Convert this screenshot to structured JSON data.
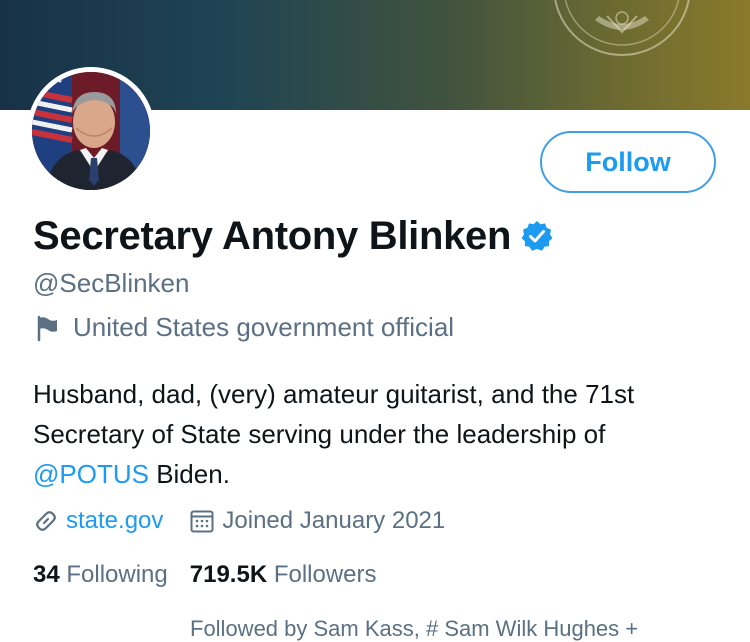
{
  "banner": {
    "colors": [
      "#173247",
      "#8a7a2b"
    ],
    "seal_icon": "state-department-seal"
  },
  "profile": {
    "display_name": "Secretary Antony Blinken",
    "verified_icon": "verified-badge-icon",
    "handle": "@SecBlinken",
    "label_icon": "flag-icon",
    "label": "United States government official",
    "bio": {
      "line1": "Husband, dad, (very) amateur guitarist, and the 71st",
      "line2": "Secretary of State serving under the leadership of",
      "mention": "@POTUS",
      "line3_rest": " Biden."
    },
    "website_icon": "link-icon",
    "website": "state.gov",
    "joined_icon": "calendar-icon",
    "joined": "Joined January 2021"
  },
  "actions": {
    "follow_label": "Follow"
  },
  "stats": {
    "following_count": "34",
    "following_label": "Following",
    "followers_count": "719.5K",
    "followers_label": "Followers"
  },
  "followed_by": "Followed by Sam Kass, # Sam Wilk Hughes +",
  "colors": {
    "accent": "#1d9bf0",
    "secondary_text": "#5b7083",
    "primary_text": "#0f1419"
  }
}
